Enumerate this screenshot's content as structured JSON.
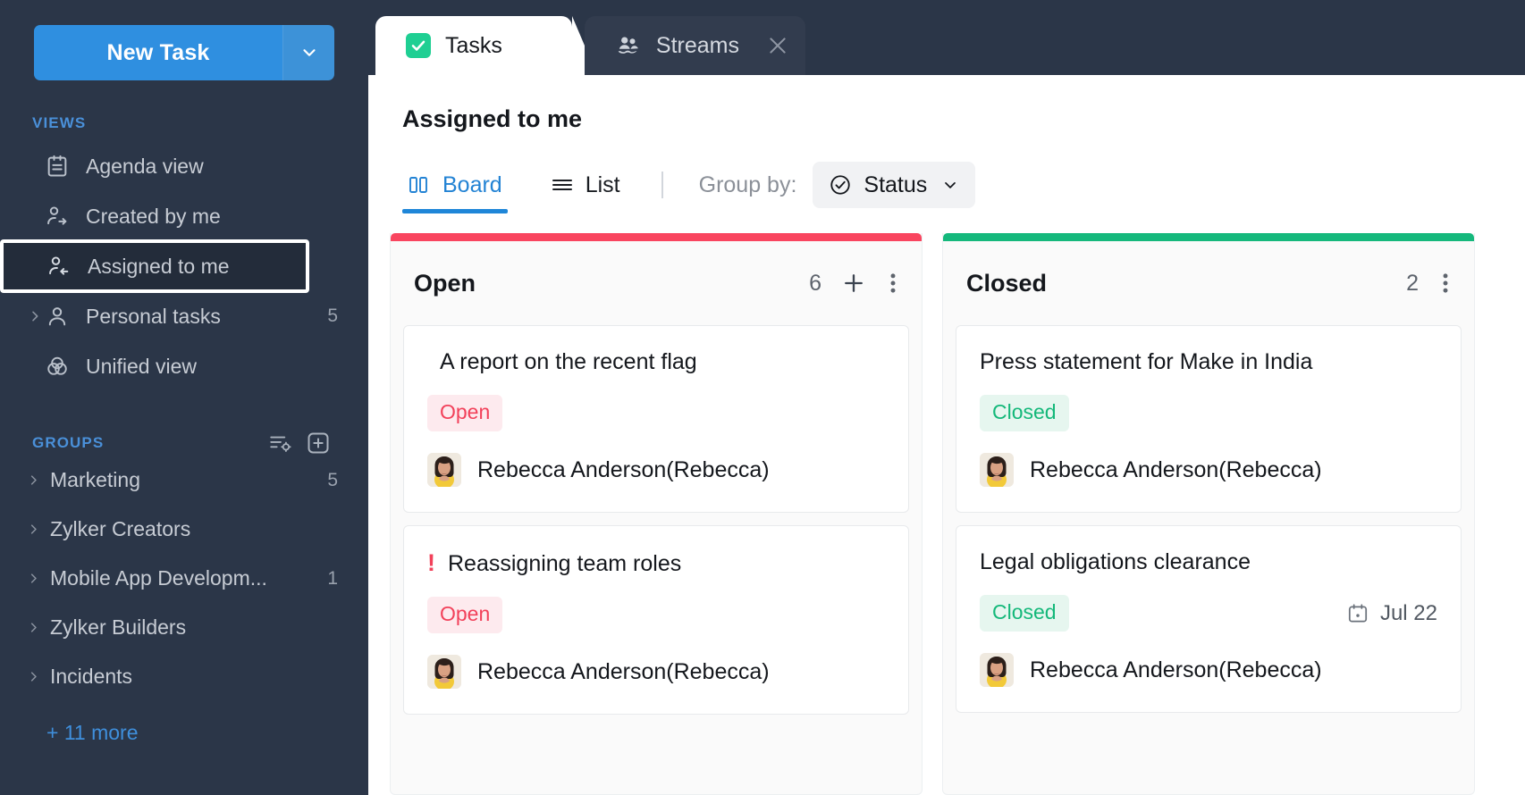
{
  "sidebar": {
    "new_task": {
      "label": "New Task",
      "caret_icon": "chevron-down-icon"
    },
    "views_label": "VIEWS",
    "views": [
      {
        "label": "Agenda view",
        "icon": "agenda-icon",
        "count": "",
        "expandable": false,
        "selected": false
      },
      {
        "label": "Created by me",
        "icon": "user-arrow-right-icon",
        "count": "",
        "expandable": false,
        "selected": false
      },
      {
        "label": "Assigned to me",
        "icon": "user-arrow-left-icon",
        "count": "",
        "expandable": false,
        "selected": true
      },
      {
        "label": "Personal tasks",
        "icon": "user-icon",
        "count": "5",
        "expandable": true,
        "selected": false
      },
      {
        "label": "Unified view",
        "icon": "unified-venn-icon",
        "count": "",
        "expandable": false,
        "selected": false
      }
    ],
    "groups_label": "GROUPS",
    "groups_actions": [
      {
        "icon": "filter-settings-icon"
      },
      {
        "icon": "add-group-icon"
      }
    ],
    "groups": [
      {
        "label": "Marketing",
        "count": "5"
      },
      {
        "label": "Zylker Creators",
        "count": ""
      },
      {
        "label": "Mobile App Developm...",
        "count": "1"
      },
      {
        "label": "Zylker Builders",
        "count": ""
      },
      {
        "label": "Incidents",
        "count": ""
      }
    ],
    "more_link": "+ 11 more"
  },
  "tabs": [
    {
      "label": "Tasks",
      "icon": "checkbox-check-icon",
      "active": true,
      "closable": false
    },
    {
      "label": "Streams",
      "icon": "streams-people-icon",
      "active": false,
      "closable": true,
      "close_icon": "close-icon"
    }
  ],
  "header": {
    "title": "Assigned to me"
  },
  "toolbar": {
    "view_tabs": [
      {
        "label": "Board",
        "icon": "board-columns-icon",
        "active": true
      },
      {
        "label": "List",
        "icon": "list-lines-icon",
        "active": false
      }
    ],
    "group_by_label": "Group by:",
    "group_by_value": "Status",
    "group_by_icon": "check-circle-icon",
    "group_by_caret": "chevron-down-icon"
  },
  "columns": [
    {
      "title": "Open",
      "count": "6",
      "accent": "#f9455f",
      "add_icon": "plus-icon",
      "menu_icon": "kebab-menu-icon",
      "cards": [
        {
          "title": "A report on the recent flag",
          "priority": "",
          "status": "Open",
          "status_type": "open",
          "due": "",
          "assignee": "Rebecca Anderson(Rebecca)"
        },
        {
          "title": "Reassigning team roles",
          "priority": "!",
          "status": "Open",
          "status_type": "open",
          "due": "",
          "assignee": "Rebecca Anderson(Rebecca)"
        }
      ]
    },
    {
      "title": "Closed",
      "count": "2",
      "accent": "#15b87c",
      "add_icon": "",
      "menu_icon": "kebab-menu-icon",
      "cards": [
        {
          "title": "Press statement for Make in India",
          "priority": "",
          "status": "Closed",
          "status_type": "closed",
          "due": "",
          "assignee": "Rebecca Anderson(Rebecca)"
        },
        {
          "title": "Legal obligations clearance",
          "priority": "",
          "status": "Closed",
          "status_type": "closed",
          "due": "Jul 22",
          "due_icon": "calendar-icon",
          "assignee": "Rebecca Anderson(Rebecca)"
        }
      ]
    }
  ],
  "colors": {
    "sidebar_bg": "#2b3648",
    "accent_blue": "#2f8fe0",
    "open_red": "#f2415a",
    "closed_green": "#14b87a",
    "tab_green": "#1fcf93"
  }
}
